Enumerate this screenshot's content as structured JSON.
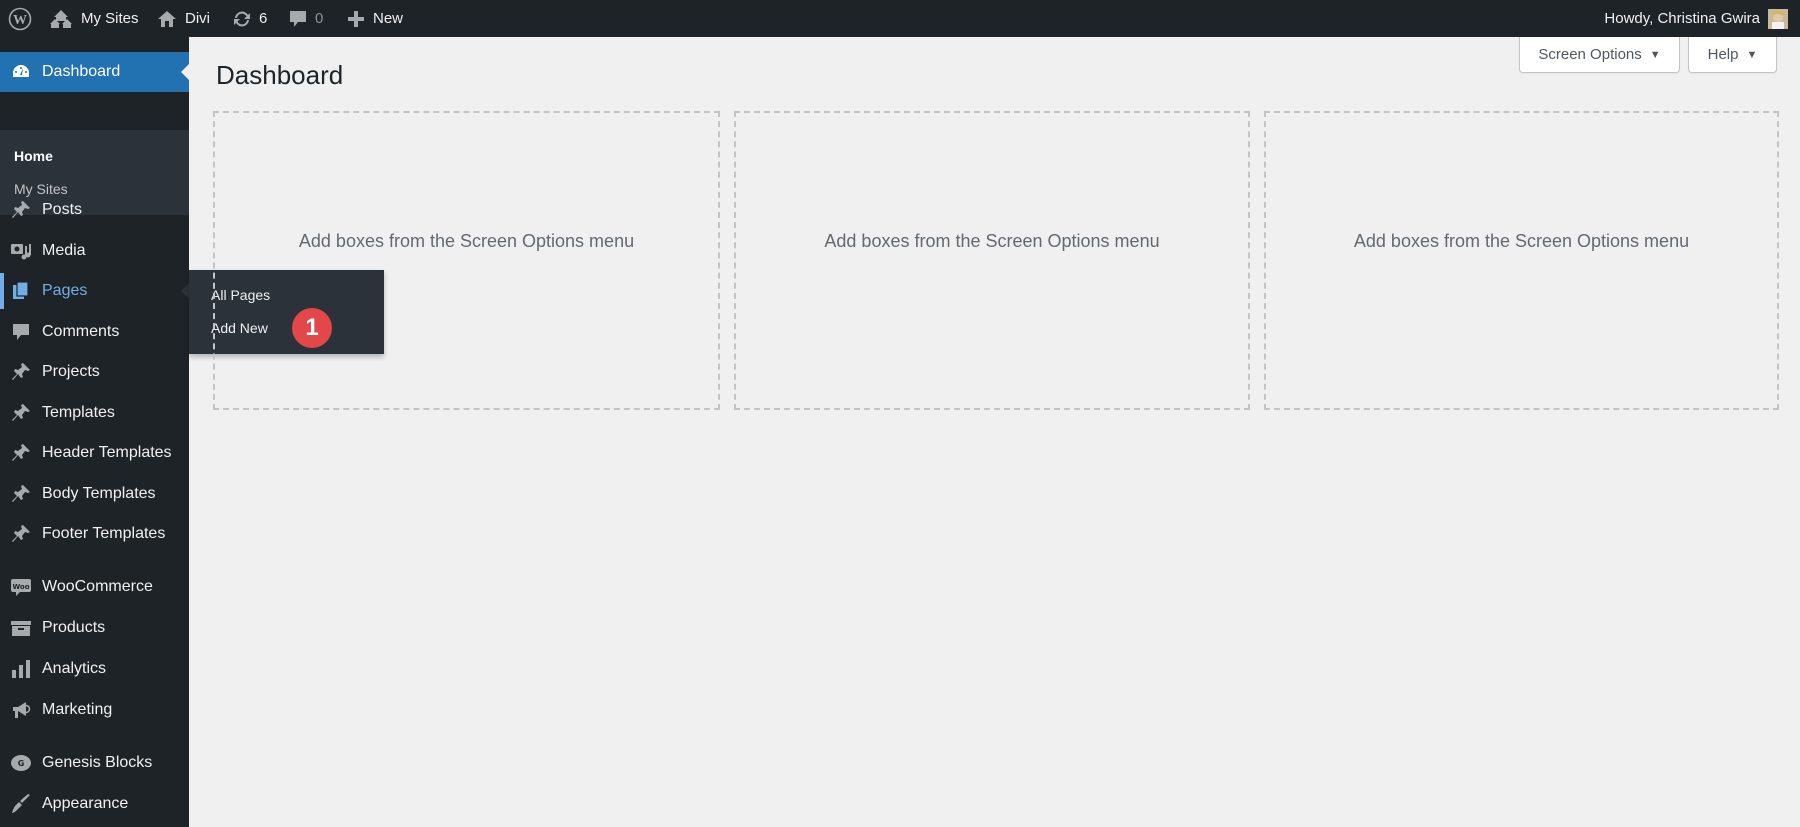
{
  "adminbar": {
    "wp_logo": "wordpress-logo-icon",
    "my_sites": {
      "icon": "my-sites-icon",
      "label": "My Sites"
    },
    "site": {
      "icon": "home-icon",
      "label": "Divi"
    },
    "updates": {
      "icon": "updates-icon",
      "count": "6"
    },
    "comments": {
      "icon": "comment-icon",
      "count": "0"
    },
    "new": {
      "icon": "plus-icon",
      "label": "New"
    },
    "account": {
      "greeting": "Howdy, Christina Gwira",
      "avatar": "user-avatar"
    }
  },
  "sidebar": {
    "dashboard": {
      "label": "Dashboard",
      "icon": "dashboard-icon",
      "submenu": [
        {
          "label": "Home",
          "current": true
        },
        {
          "label": "My Sites"
        }
      ]
    },
    "items": [
      {
        "label": "Posts",
        "icon": "pin-icon"
      },
      {
        "label": "Media",
        "icon": "media-icon"
      },
      {
        "label": "Pages",
        "icon": "pages-icon",
        "open": true
      },
      {
        "label": "Comments",
        "icon": "comment-icon"
      },
      {
        "label": "Projects",
        "icon": "pin-icon"
      },
      {
        "label": "Templates",
        "icon": "pin-icon"
      },
      {
        "label": "Header Templates",
        "icon": "pin-icon"
      },
      {
        "label": "Body Templates",
        "icon": "pin-icon"
      },
      {
        "label": "Footer Templates",
        "icon": "pin-icon"
      },
      {
        "label": "WooCommerce",
        "icon": "woo-icon"
      },
      {
        "label": "Products",
        "icon": "archive-icon"
      },
      {
        "label": "Analytics",
        "icon": "bar-chart-icon"
      },
      {
        "label": "Marketing",
        "icon": "megaphone-icon"
      },
      {
        "label": "Genesis Blocks",
        "icon": "genesis-icon"
      },
      {
        "label": "Appearance",
        "icon": "brush-icon"
      }
    ],
    "pages_flyout": [
      {
        "label": "All Pages"
      },
      {
        "label": "Add New"
      }
    ]
  },
  "annotation": {
    "step": "1",
    "color": "#e2484a"
  },
  "main": {
    "title": "Dashboard",
    "screen_options": "Screen Options",
    "help": "Help",
    "arrow": "▼",
    "boxes": [
      {
        "placeholder": "Add boxes from the Screen Options menu"
      },
      {
        "placeholder": "Add boxes from the Screen Options menu"
      },
      {
        "placeholder": "Add boxes from the Screen Options menu"
      }
    ]
  },
  "colors": {
    "adminbar_bg": "#1d2327",
    "sidebar_bg": "#1d2327",
    "submenu_bg": "#2c3338",
    "accent": "#2271b1",
    "active_text": "#72aee6",
    "page_bg": "#f0f0f1"
  }
}
